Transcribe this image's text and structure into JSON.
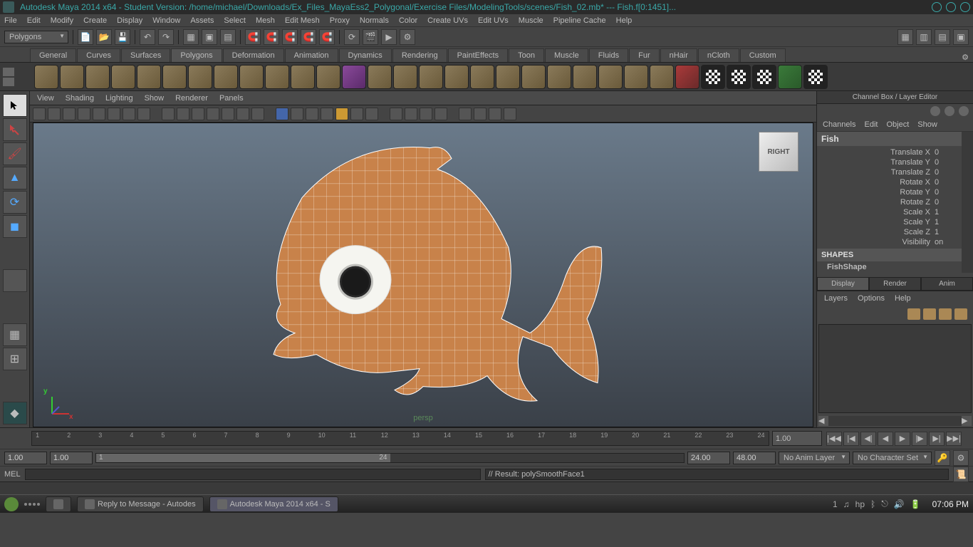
{
  "titlebar": {
    "title": "Autodesk Maya 2014 x64 - Student Version: /home/michael/Downloads/Ex_Files_MayaEss2_Polygonal/Exercise Files/ModelingTools/scenes/Fish_02.mb*  ---   Fish.f[0:1451]..."
  },
  "menubar": [
    "File",
    "Edit",
    "Modify",
    "Create",
    "Display",
    "Window",
    "Assets",
    "Select",
    "Mesh",
    "Edit Mesh",
    "Proxy",
    "Normals",
    "Color",
    "Create UVs",
    "Edit UVs",
    "Muscle",
    "Pipeline Cache",
    "Help"
  ],
  "status_mode": "Polygons",
  "shelftabs": [
    "General",
    "Curves",
    "Surfaces",
    "Polygons",
    "Deformation",
    "Animation",
    "Dynamics",
    "Rendering",
    "PaintEffects",
    "Toon",
    "Muscle",
    "Fluids",
    "Fur",
    "nHair",
    "nCloth",
    "Custom"
  ],
  "active_shelf_tab": "Polygons",
  "viewport_menus": [
    "View",
    "Shading",
    "Lighting",
    "Show",
    "Renderer",
    "Panels"
  ],
  "persp_label": "persp",
  "viewcube_label": "RIGHT",
  "rightpanel": {
    "title": "Channel Box / Layer Editor",
    "top_menus": [
      "Channels",
      "Edit",
      "Object",
      "Show"
    ],
    "object_name": "Fish",
    "attrs": [
      {
        "lbl": "Translate X",
        "val": "0"
      },
      {
        "lbl": "Translate Y",
        "val": "0"
      },
      {
        "lbl": "Translate Z",
        "val": "0"
      },
      {
        "lbl": "Rotate X",
        "val": "0"
      },
      {
        "lbl": "Rotate Y",
        "val": "0"
      },
      {
        "lbl": "Rotate Z",
        "val": "0"
      },
      {
        "lbl": "Scale X",
        "val": "1"
      },
      {
        "lbl": "Scale Y",
        "val": "1"
      },
      {
        "lbl": "Scale Z",
        "val": "1"
      },
      {
        "lbl": "Visibility",
        "val": "on"
      }
    ],
    "shapes_label": "SHAPES",
    "shape_name": "FishShape",
    "layer_tabs": [
      "Display",
      "Render",
      "Anim"
    ],
    "layer_menus": [
      "Layers",
      "Options",
      "Help"
    ]
  },
  "timeline": {
    "ticks": [
      "1",
      "2",
      "3",
      "4",
      "5",
      "6",
      "7",
      "8",
      "9",
      "10",
      "11",
      "12",
      "13",
      "14",
      "15",
      "16",
      "17",
      "18",
      "19",
      "20",
      "21",
      "22",
      "23",
      "24"
    ],
    "current": "1.00"
  },
  "range": {
    "start_outer": "1.00",
    "start_inner": "1.00",
    "end_inner": "24.00",
    "end_outer": "48.00",
    "slider_start": "1",
    "slider_end": "24",
    "anim_layer": "No Anim Layer",
    "char_set": "No Character Set"
  },
  "cmdline": {
    "lang": "MEL",
    "result": "// Result: polySmoothFace1"
  },
  "taskbar": {
    "tasks": [
      "Reply to Message - Autodes",
      "Autodesk Maya 2014 x64 - S"
    ],
    "workspace": "1",
    "clock": "07:06 PM"
  }
}
